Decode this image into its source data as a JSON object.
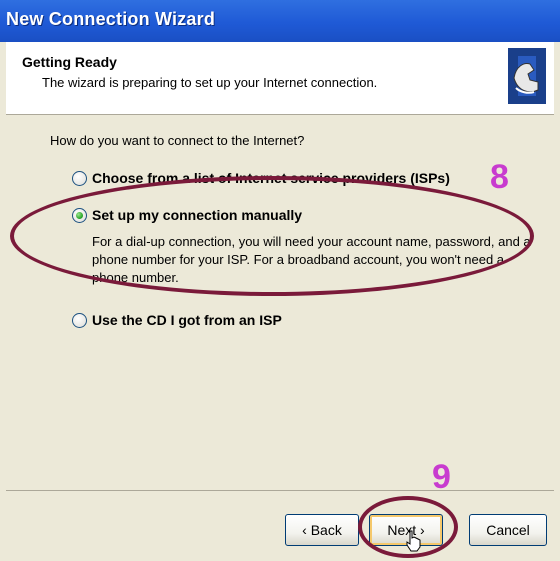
{
  "window": {
    "title": "New Connection Wizard"
  },
  "header": {
    "title": "Getting Ready",
    "subtitle": "The wizard is preparing to set up your Internet connection."
  },
  "content": {
    "question": "How do you want to connect to the Internet?",
    "options": [
      {
        "label": "Choose from a list of Internet service providers (ISPs)",
        "checked": false
      },
      {
        "label": "Set up my connection manually",
        "checked": true
      },
      {
        "label": "Use the CD I got from an ISP",
        "checked": false
      }
    ],
    "description": "For a dial-up connection, you will need your account name, password, and a phone number for your ISP. For a broadband account, you won't need a phone number."
  },
  "footer": {
    "back_label": "‹ Back",
    "next_label": "Next ›",
    "cancel_label": "Cancel"
  },
  "annotations": {
    "step_8": "8",
    "step_9": "9",
    "color": "#c83bcf",
    "ellipse_color": "#7a1a3a"
  }
}
